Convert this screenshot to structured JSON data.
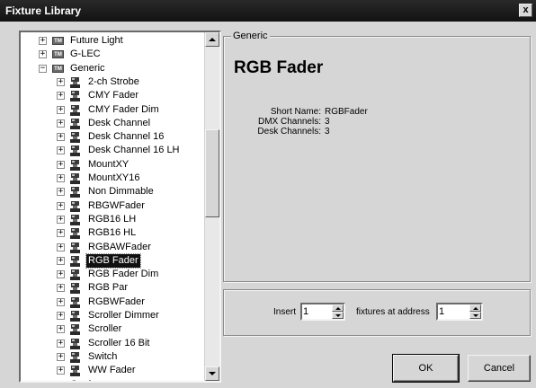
{
  "window": {
    "title": "Fixture Library",
    "close_label": "x"
  },
  "tree": {
    "items": [
      {
        "level": 0,
        "type": "manufacturer",
        "expander": "+",
        "badge": "TM",
        "label": "Future Light"
      },
      {
        "level": 0,
        "type": "manufacturer",
        "expander": "+",
        "badge": "TM",
        "label": "G-LEC"
      },
      {
        "level": 0,
        "type": "manufacturer",
        "expander": "−",
        "badge": "TM",
        "label": "Generic"
      },
      {
        "level": 1,
        "type": "fixture",
        "expander": "+",
        "label": "2-ch Strobe"
      },
      {
        "level": 1,
        "type": "fixture",
        "expander": "+",
        "label": "CMY Fader"
      },
      {
        "level": 1,
        "type": "fixture",
        "expander": "+",
        "label": "CMY Fader Dim"
      },
      {
        "level": 1,
        "type": "fixture",
        "expander": "+",
        "label": "Desk Channel"
      },
      {
        "level": 1,
        "type": "fixture",
        "expander": "+",
        "label": "Desk Channel 16"
      },
      {
        "level": 1,
        "type": "fixture",
        "expander": "+",
        "label": "Desk Channel 16 LH"
      },
      {
        "level": 1,
        "type": "fixture",
        "expander": "+",
        "label": "MountXY"
      },
      {
        "level": 1,
        "type": "fixture",
        "expander": "+",
        "label": "MountXY16"
      },
      {
        "level": 1,
        "type": "fixture",
        "expander": "+",
        "label": "Non Dimmable"
      },
      {
        "level": 1,
        "type": "fixture",
        "expander": "+",
        "label": "RBGWFader"
      },
      {
        "level": 1,
        "type": "fixture",
        "expander": "+",
        "label": "RGB16 LH"
      },
      {
        "level": 1,
        "type": "fixture",
        "expander": "+",
        "label": "RGB16 HL"
      },
      {
        "level": 1,
        "type": "fixture",
        "expander": "+",
        "label": "RGBAWFader"
      },
      {
        "level": 1,
        "type": "fixture",
        "expander": "+",
        "label": "RGB Fader",
        "selected": true
      },
      {
        "level": 1,
        "type": "fixture",
        "expander": "+",
        "label": "RGB Fader Dim"
      },
      {
        "level": 1,
        "type": "fixture",
        "expander": "+",
        "label": "RGB Par"
      },
      {
        "level": 1,
        "type": "fixture",
        "expander": "+",
        "label": "RGBWFader"
      },
      {
        "level": 1,
        "type": "fixture",
        "expander": "+",
        "label": "Scroller Dimmer"
      },
      {
        "level": 1,
        "type": "fixture",
        "expander": "+",
        "label": "Scroller"
      },
      {
        "level": 1,
        "type": "fixture",
        "expander": "+",
        "label": "Scroller 16 Bit"
      },
      {
        "level": 1,
        "type": "fixture",
        "expander": "+",
        "label": "Switch"
      },
      {
        "level": 1,
        "type": "fixture",
        "expander": "+",
        "label": "WW Fader"
      },
      {
        "level": 0,
        "type": "manufacturer",
        "expander": "+",
        "badge": "TM",
        "label": "Geni"
      }
    ]
  },
  "details": {
    "group_label": "Generic",
    "fixture_name": "RGB Fader",
    "fields": [
      {
        "key": "Short Name:",
        "value": "RGBFader"
      },
      {
        "key": "DMX Channels:",
        "value": "3"
      },
      {
        "key": "Desk Channels:",
        "value": "3"
      }
    ]
  },
  "insert": {
    "insert_label": "Insert",
    "count_value": "1",
    "fixtures_label": "fixtures  at address",
    "address_value": "1"
  },
  "buttons": {
    "ok_label": "OK",
    "cancel_label": "Cancel"
  }
}
